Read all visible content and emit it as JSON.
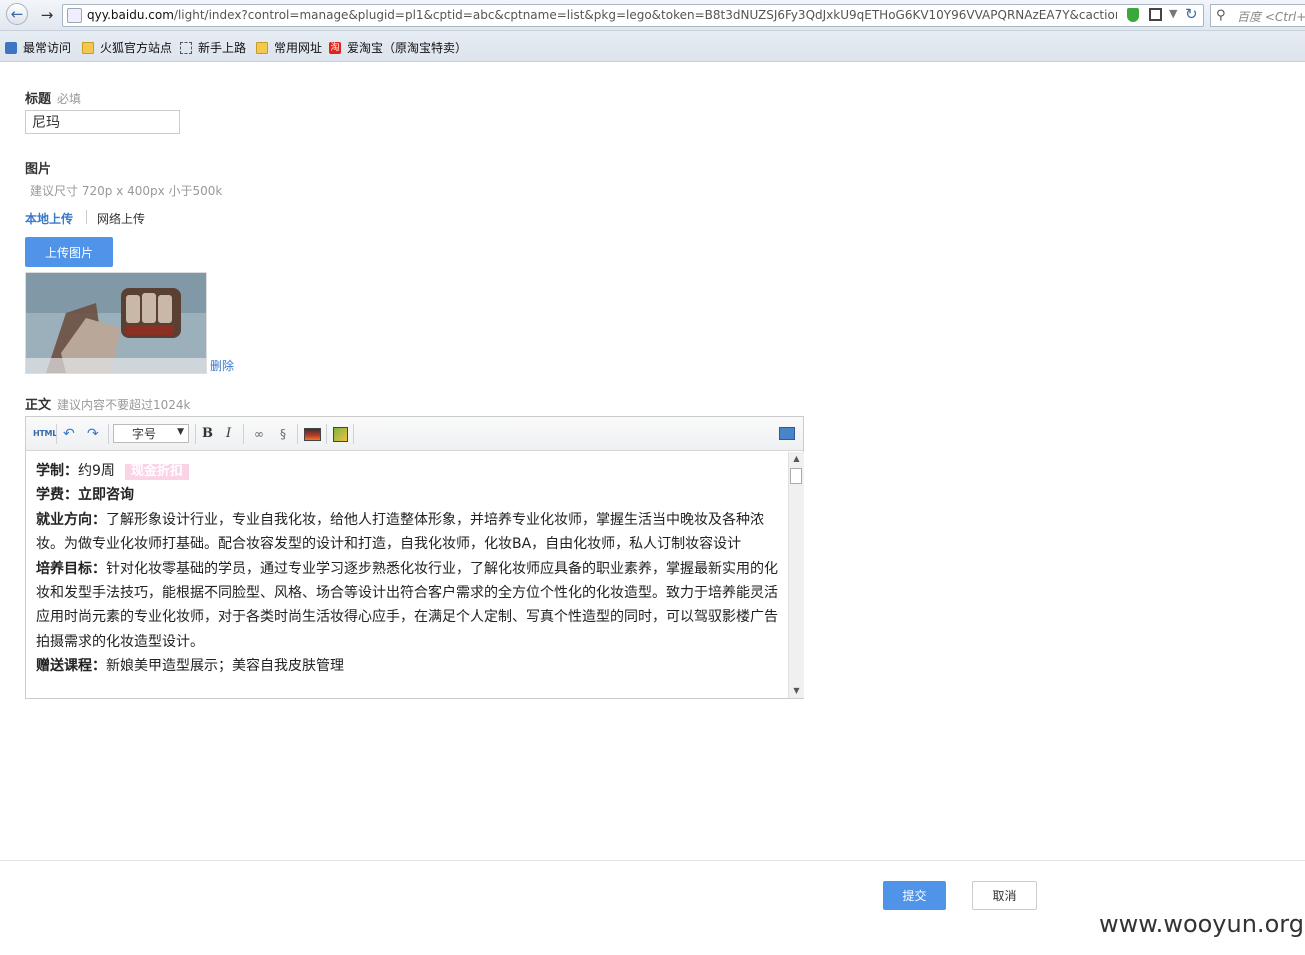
{
  "browser": {
    "url_host": "qyy.baidu.com",
    "url_path": "/light/index?control=manage&plugid=pl1&cptid=abc&cptname=list&pkg=lego&token=B8t3dNUZSJ6Fy3QdJxkU9qETHoG6KV10Y96VVAPQRNAzEA7Y&caction=ad",
    "search_placeholder": "百度 <Ctrl+K>"
  },
  "bookmarks": [
    {
      "label": "最常访问",
      "icon": "most-visited-icon"
    },
    {
      "label": "火狐官方站点",
      "icon": "folder-icon"
    },
    {
      "label": "新手上路",
      "icon": "dashed-folder-icon"
    },
    {
      "label": "常用网址",
      "icon": "folder-icon"
    },
    {
      "label": "爱淘宝（原淘宝特卖）",
      "icon": "taobao-icon",
      "icon_text": "淘"
    }
  ],
  "form": {
    "title_label": "标题",
    "title_required": "必填",
    "title_value": "尼玛",
    "image_label": "图片",
    "image_hint": "建议尺寸 720p x 400px 小于500k",
    "tab_local": "本地上传",
    "tab_network": "网络上传",
    "upload_button": "上传图片",
    "delete_link": "删除",
    "body_label": "正文",
    "body_hint": "建议内容不要超过1024k"
  },
  "editor": {
    "toolbar": {
      "html": "HTML",
      "font_size": "字号",
      "bold": "B",
      "italic": "I"
    },
    "content": {
      "line1_label": "学制：",
      "line1_value": "约9周",
      "line1_badge": "现金折扣",
      "line2_label": "学费：",
      "line2_value": "立即咨询",
      "para1_label": "就业方向：",
      "para1_text": "了解形象设计行业，专业自我化妆，给他人打造整体形象，并培养专业化妆师，掌握生活当中晚妆及各种浓妆。为做专业化妆师打基础。配合妆容发型的设计和打造，自我化妆师，化妆BA，自由化妆师，私人订制妆容设计",
      "para2_label": "培养目标：",
      "para2_text": "针对化妆零基础的学员，通过专业学习逐步熟悉化妆行业，了解化妆师应具备的职业素养，掌握最新实用的化妆和发型手法技巧，能根据不同脸型、风格、场合等设计出符合客户需求的全方位个性化的化妆造型。致力于培养能灵活应用时尚元素的专业化妆师，对于各类时尚生活妆得心应手，在满足个人定制、写真个性造型的同时，可以驾驭影楼广告拍摄需求的化妆造型设计。",
      "para3_label": "赠送课程：",
      "para3_text": "新娘美甲造型展示；美容自我皮肤管理"
    }
  },
  "actions": {
    "submit": "提交",
    "cancel": "取消"
  },
  "watermark": "www.wooyun.org"
}
